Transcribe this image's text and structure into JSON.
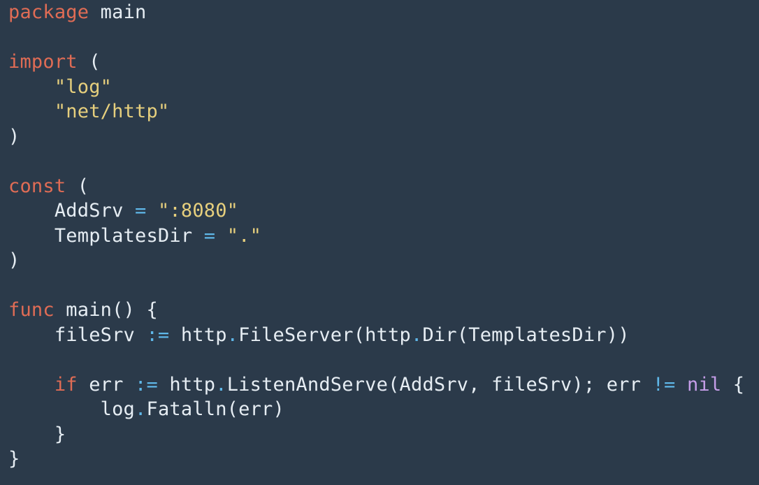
{
  "editor": {
    "theme": {
      "background": "#2b3a4a",
      "plain": "#e6edf3",
      "keyword": "#e06c55",
      "string": "#e6cf7d",
      "operator": "#5fb7e8",
      "constant": "#c59de8"
    },
    "lines": [
      [
        {
          "t": "keyword",
          "v": "package"
        },
        {
          "t": "plain",
          "v": " main"
        }
      ],
      [],
      [
        {
          "t": "keyword",
          "v": "import"
        },
        {
          "t": "plain",
          "v": " ("
        }
      ],
      [
        {
          "t": "plain",
          "v": "    "
        },
        {
          "t": "string",
          "v": "\"log\""
        }
      ],
      [
        {
          "t": "plain",
          "v": "    "
        },
        {
          "t": "string",
          "v": "\"net/http\""
        }
      ],
      [
        {
          "t": "plain",
          "v": ")"
        }
      ],
      [],
      [
        {
          "t": "keyword",
          "v": "const"
        },
        {
          "t": "plain",
          "v": " ("
        }
      ],
      [
        {
          "t": "plain",
          "v": "    AddSrv "
        },
        {
          "t": "op",
          "v": "="
        },
        {
          "t": "plain",
          "v": " "
        },
        {
          "t": "string",
          "v": "\":8080\""
        }
      ],
      [
        {
          "t": "plain",
          "v": "    TemplatesDir "
        },
        {
          "t": "op",
          "v": "="
        },
        {
          "t": "plain",
          "v": " "
        },
        {
          "t": "string",
          "v": "\".\""
        }
      ],
      [
        {
          "t": "plain",
          "v": ")"
        }
      ],
      [],
      [
        {
          "t": "keyword",
          "v": "func"
        },
        {
          "t": "plain",
          "v": " main() {"
        }
      ],
      [
        {
          "t": "plain",
          "v": "    fileSrv "
        },
        {
          "t": "op",
          "v": ":="
        },
        {
          "t": "plain",
          "v": " http"
        },
        {
          "t": "op",
          "v": "."
        },
        {
          "t": "plain",
          "v": "FileServer(http"
        },
        {
          "t": "op",
          "v": "."
        },
        {
          "t": "plain",
          "v": "Dir(TemplatesDir))"
        }
      ],
      [],
      [
        {
          "t": "plain",
          "v": "    "
        },
        {
          "t": "keyword",
          "v": "if"
        },
        {
          "t": "plain",
          "v": " err "
        },
        {
          "t": "op",
          "v": ":="
        },
        {
          "t": "plain",
          "v": " http"
        },
        {
          "t": "op",
          "v": "."
        },
        {
          "t": "plain",
          "v": "ListenAndServe(AddSrv, fileSrv); err "
        },
        {
          "t": "op",
          "v": "!="
        },
        {
          "t": "plain",
          "v": " "
        },
        {
          "t": "nil",
          "v": "nil"
        },
        {
          "t": "plain",
          "v": " {"
        }
      ],
      [
        {
          "t": "plain",
          "v": "        log"
        },
        {
          "t": "op",
          "v": "."
        },
        {
          "t": "plain",
          "v": "Fatalln(err)"
        }
      ],
      [
        {
          "t": "plain",
          "v": "    }"
        }
      ],
      [
        {
          "t": "plain",
          "v": "}"
        }
      ]
    ]
  }
}
